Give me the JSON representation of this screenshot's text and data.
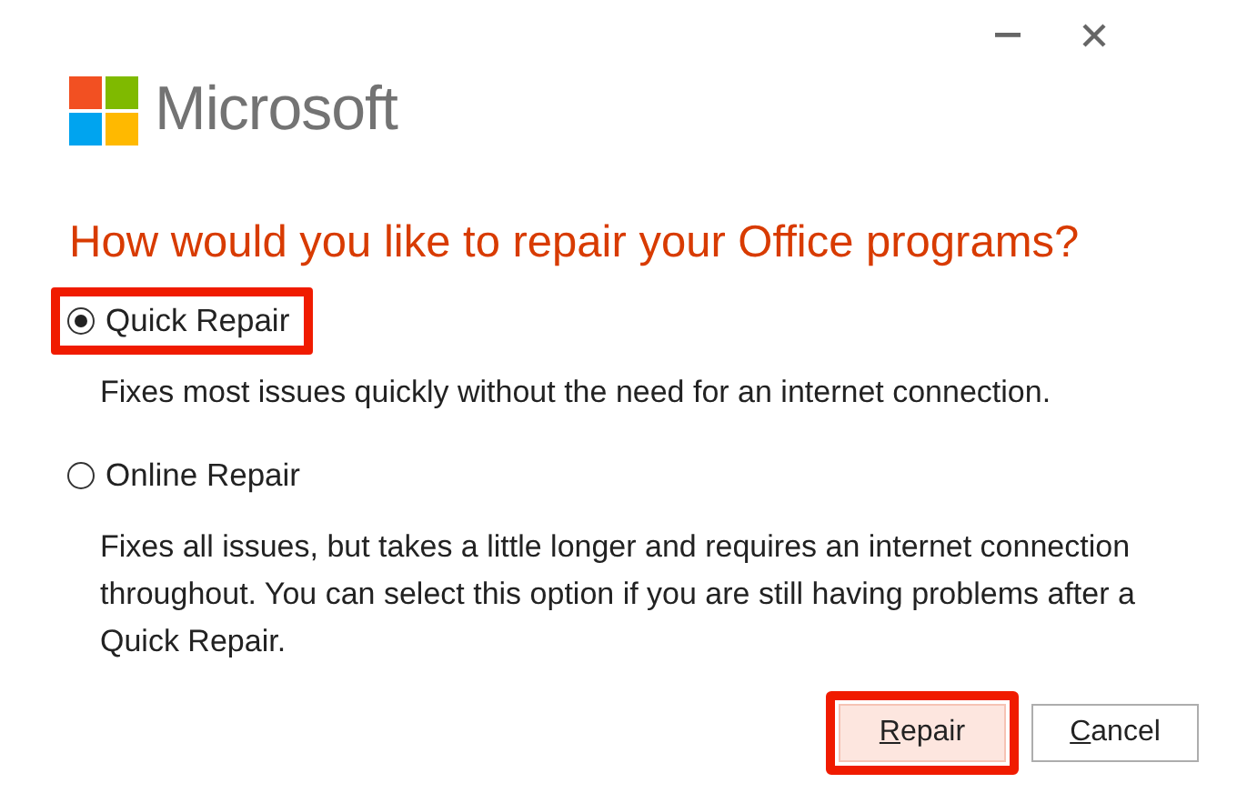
{
  "window": {
    "controls": [
      {
        "kind": "minimize"
      },
      {
        "kind": "close"
      }
    ]
  },
  "brand": "Microsoft",
  "heading": "How would you like to repair your Office programs?",
  "options": [
    {
      "label": "Quick Repair",
      "selected": true,
      "highlighted": true,
      "description": "Fixes most issues quickly without the need for an internet connection."
    },
    {
      "label": "Online Repair",
      "selected": false,
      "highlighted": false,
      "description": "Fixes all issues, but takes a little longer and requires an internet connection throughout. You can select this option if you are still having problems after a Quick Repair."
    }
  ],
  "buttons": [
    {
      "label": "Repair",
      "default": true,
      "highlighted": true,
      "mnemonic_first": true
    },
    {
      "label": "Cancel",
      "default": false,
      "highlighted": false,
      "mnemonic_first": true
    }
  ]
}
